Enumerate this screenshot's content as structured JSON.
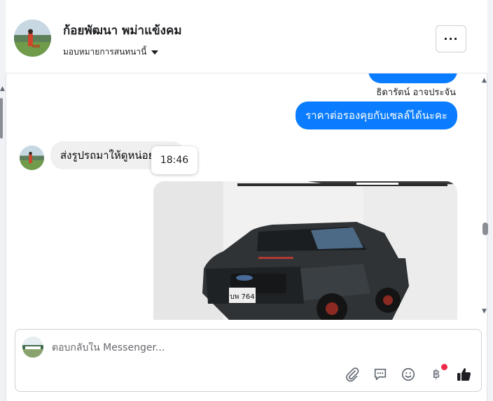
{
  "header": {
    "contact_name": "ก้อยพัฒนา พม่าแข้งคม",
    "assign_label": "มอบหมายการสนทนานี้",
    "more_label": "···"
  },
  "chat": {
    "top_cut_bubble": "",
    "sender_name": "ธิดารัตน์ อาจประจัน",
    "outgoing_message": "ราคาต่อรองคุยกับเซลล์ได้นะคะ",
    "incoming_message": "ส่งรูปรถมาให้ดูหน่อย",
    "tooltip_time": "18:46"
  },
  "composer": {
    "placeholder": "ตอบกลับใน Messenger...",
    "currency_symbol": "฿"
  },
  "colors": {
    "accent": "#0a7cff",
    "incoming_bubble": "#f0f0f0",
    "badge": "#f02849"
  },
  "icons": [
    "chevron-down-icon",
    "more-icon",
    "paperclip-icon",
    "comment-icon",
    "emoji-icon",
    "baht-icon",
    "thumbs-up-icon"
  ]
}
